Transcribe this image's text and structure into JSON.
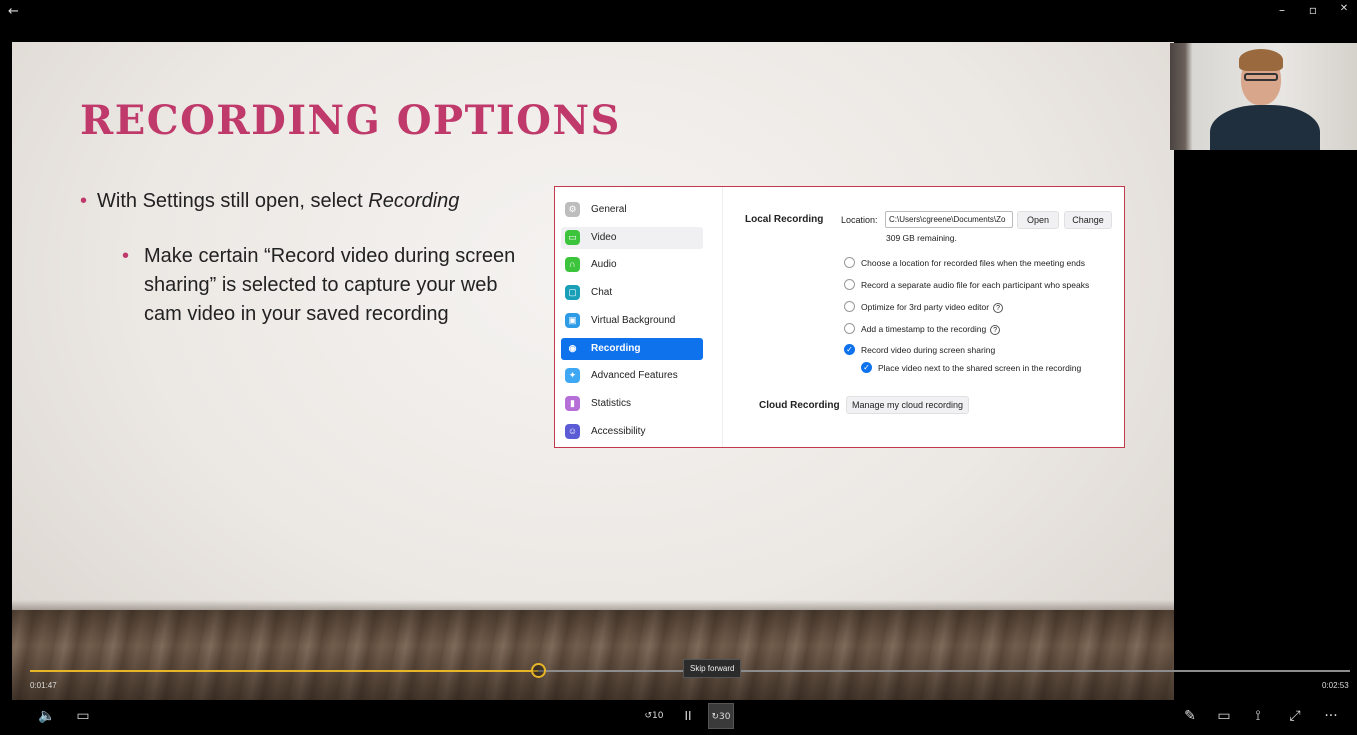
{
  "titlebar": {
    "back_icon": "←",
    "minimize_icon": "–",
    "restore_icon": "▫",
    "close_icon": "✕"
  },
  "slide": {
    "title": "RECORDING OPTIONS",
    "bullet1_prefix": "With Settings still open, select ",
    "bullet1_emph": "Recording",
    "bullet2": "Make certain “Record video during screen sharing” is selected to capture your web cam video in your saved recording"
  },
  "settings_nav": [
    {
      "label": "General",
      "color": "#bdbdbd",
      "glyph": "⚙"
    },
    {
      "label": "Video",
      "color": "#3dc43d",
      "glyph": "▭"
    },
    {
      "label": "Audio",
      "color": "#3dc43d",
      "glyph": "∩"
    },
    {
      "label": "Chat",
      "color": "#19a0b8",
      "glyph": "▢"
    },
    {
      "label": "Virtual Background",
      "color": "#2e9be6",
      "glyph": "▣"
    },
    {
      "label": "Recording",
      "color": "#0e72ed",
      "glyph": "◉"
    },
    {
      "label": "Advanced Features",
      "color": "#3fa8f4",
      "glyph": "✦"
    },
    {
      "label": "Statistics",
      "color": "#b56fd6",
      "glyph": "▮"
    },
    {
      "label": "Accessibility",
      "color": "#5b5bd6",
      "glyph": "☺"
    }
  ],
  "local_recording": {
    "label": "Local Recording",
    "location_label": "Location:",
    "location_value": "C:\\Users\\cgreene\\Documents\\Zo",
    "open_button": "Open",
    "change_button": "Change",
    "remaining": "309 GB remaining.",
    "options": [
      {
        "text": "Choose a location for recorded files when the meeting ends",
        "checked": false,
        "help": false
      },
      {
        "text": "Record a separate audio file for each participant who speaks",
        "checked": false,
        "help": false
      },
      {
        "text": "Optimize for 3rd party video editor",
        "checked": false,
        "help": true
      },
      {
        "text": "Add a timestamp to the recording",
        "checked": false,
        "help": true
      },
      {
        "text": "Record video during screen sharing",
        "checked": true,
        "help": false
      },
      {
        "text": "Place video next to the shared screen in the recording",
        "checked": true,
        "help": false
      }
    ]
  },
  "cloud_recording": {
    "label": "Cloud Recording",
    "button": "Manage my cloud recording"
  },
  "player": {
    "current_time": "0:01:47",
    "total_time": "0:02:53",
    "progress": 0.385,
    "tooltip": "Skip forward",
    "volume_icon": "🔈",
    "captions_icon": "▭",
    "rewind_label": "10",
    "pause_icon": "II",
    "forward_label": "30",
    "pen_icon": "✎",
    "miniview_icon": "▭",
    "cast_icon": "⟟",
    "fullscreen_icon": "⤢",
    "more_icon": "···",
    "accent": "#e8b526"
  }
}
